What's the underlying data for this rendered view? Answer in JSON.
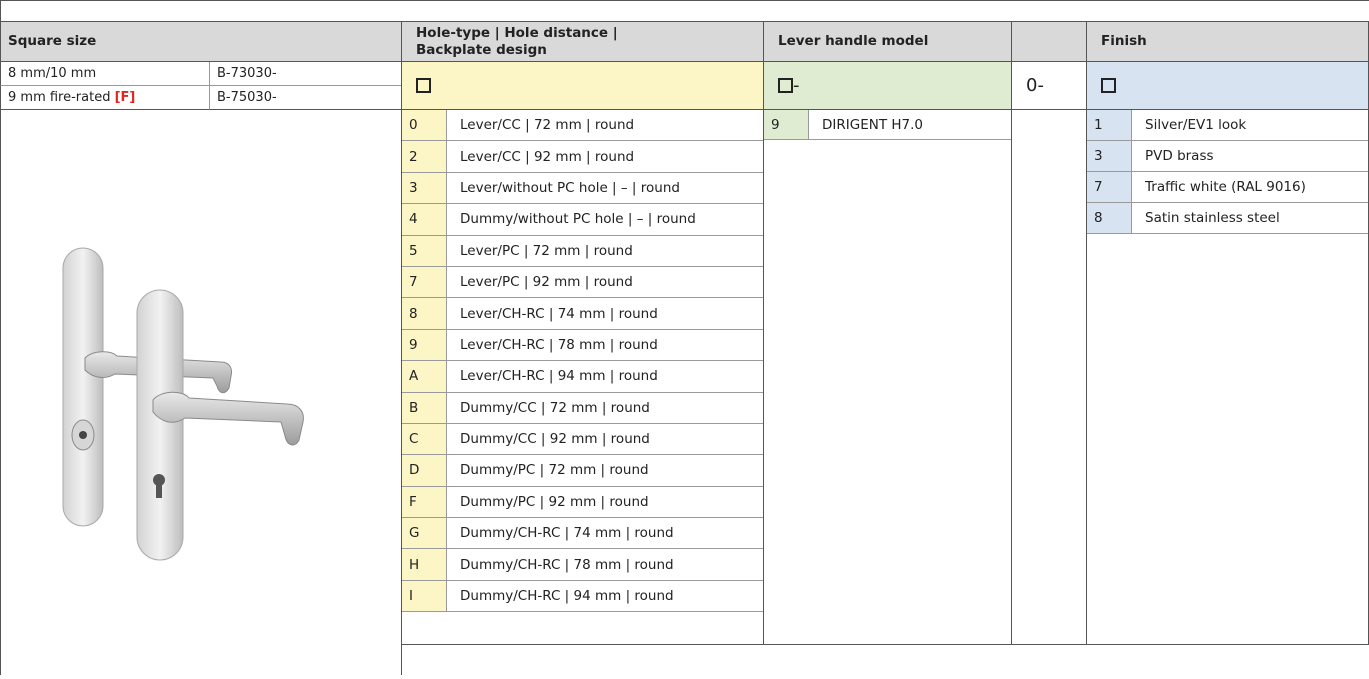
{
  "headers": {
    "square_size": "Square size",
    "hole_type": "Hole-type | Hole distance |",
    "hole_type_2": "Backplate design",
    "lever_model": "Lever handle model",
    "finish": "Finish"
  },
  "square_rows": [
    {
      "label": "8 mm/10 mm",
      "suffix": "",
      "code": "B-73030-"
    },
    {
      "label": "9 mm fire-rated ",
      "suffix": "[F]",
      "code": "B-75030-"
    }
  ],
  "code_row": {
    "lever_suffix": "-",
    "fixed": "0-"
  },
  "hole_types": [
    {
      "code": "0",
      "text": "Lever/CC | 72 mm | round"
    },
    {
      "code": "2",
      "text": "Lever/CC | 92 mm | round"
    },
    {
      "code": "3",
      "text": "Lever/without PC hole | – | round"
    },
    {
      "code": "4",
      "text": "Dummy/without PC hole | – | round"
    },
    {
      "code": "5",
      "text": "Lever/PC | 72 mm | round"
    },
    {
      "code": "7",
      "text": "Lever/PC | 92 mm | round"
    },
    {
      "code": "8",
      "text": "Lever/CH-RC | 74 mm | round"
    },
    {
      "code": "9",
      "text": "Lever/CH-RC | 78 mm | round"
    },
    {
      "code": "A",
      "text": "Lever/CH-RC | 94 mm | round"
    },
    {
      "code": "B",
      "text": "Dummy/CC | 72 mm | round"
    },
    {
      "code": "C",
      "text": "Dummy/CC | 92 mm | round"
    },
    {
      "code": "D",
      "text": "Dummy/PC | 72 mm | round"
    },
    {
      "code": "F",
      "text": "Dummy/PC | 92 mm | round"
    },
    {
      "code": "G",
      "text": "Dummy/CH-RC | 74 mm | round"
    },
    {
      "code": "H",
      "text": "Dummy/CH-RC | 78 mm | round"
    },
    {
      "code": "I",
      "text": "Dummy/CH-RC | 94 mm | round"
    }
  ],
  "lever_models": [
    {
      "code": "9",
      "text": "DIRIGENT H7.0"
    }
  ],
  "finishes": [
    {
      "code": "1",
      "text": "Silver/EV1 look"
    },
    {
      "code": "3",
      "text": "PVD brass"
    },
    {
      "code": "7",
      "text": "Traffic white (RAL 9016)"
    },
    {
      "code": "8",
      "text": "Satin stainless steel"
    }
  ],
  "colors": {
    "header_bg": "#d9d9d9",
    "hole_type_bg": "#fcf5c6",
    "lever_bg": "#e0ecd1",
    "finish_bg": "#d8e3f2",
    "fire_rated": "#e2261f"
  },
  "image": {
    "icon": "door-lever-handle-set-illustration"
  }
}
